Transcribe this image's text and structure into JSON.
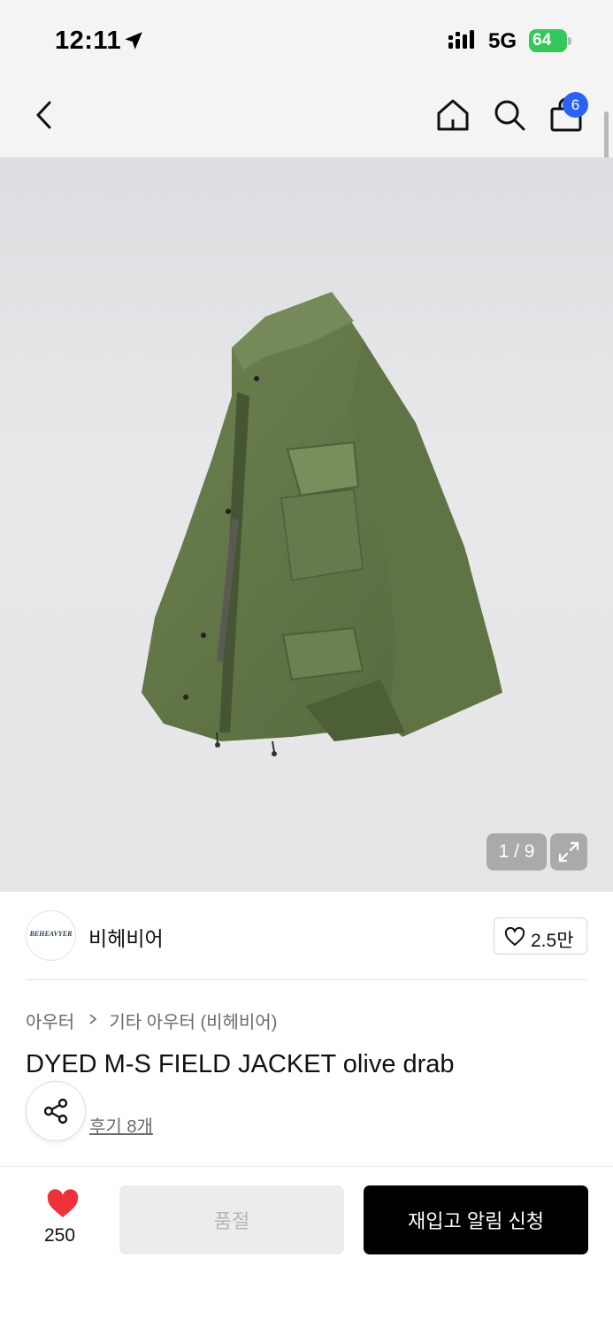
{
  "status_bar": {
    "time": "12:11",
    "network": "5G",
    "battery": "64",
    "location_icon": "location-arrow-icon",
    "signal_icon": "cellular-signal-icon"
  },
  "nav": {
    "back_icon": "chevron-left-icon",
    "home_icon": "home-icon",
    "search_icon": "search-icon",
    "bag_icon": "shopping-bag-icon",
    "bag_badge": "6",
    "badge_color": "#2a62f5"
  },
  "gallery": {
    "counter": "1 / 9",
    "expand_icon": "expand-icon",
    "current_image": 1,
    "total_images": 9
  },
  "brand": {
    "logo_text": "BEHEAVYER",
    "name": "비헤비어",
    "likes": "2.5만",
    "like_icon": "heart-outline-icon"
  },
  "product": {
    "breadcrumb": [
      "아우터",
      "기타 아우터 (비헤비어)"
    ],
    "title": "DYED M-S FIELD JACKET olive drab",
    "reviews": "후기 8개",
    "share_icon": "share-icon"
  },
  "bottom_bar": {
    "wish_count": "250",
    "wish_icon": "heart-filled-icon",
    "wish_color": "#f0303a",
    "soldout_label": "품절",
    "restock_label": "재입고 알림 신청"
  }
}
